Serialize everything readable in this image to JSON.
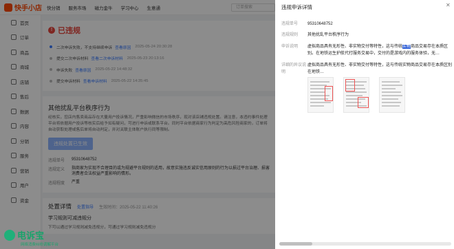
{
  "topbar": {
    "logo_text": "快手小店",
    "nav": [
      "快分销",
      "服务市场",
      "磁力金牛",
      "学习中心",
      "生意通"
    ],
    "search_placeholder": "订单搜索"
  },
  "sidebar": {
    "items": [
      "首页",
      "订单",
      "商品",
      "商城",
      "店铺",
      "售后",
      "数据",
      "内容",
      "分销",
      "服务",
      "营销",
      "用户",
      "资金"
    ]
  },
  "main": {
    "status": "已违规",
    "timeline": [
      {
        "text": "二次申诉失败，不支持继续申诉",
        "link": "查看原因",
        "time": "2025-05-24 20:30:28"
      },
      {
        "text": "提交二次申诉材料",
        "link": "查看二次申诉材料",
        "time": "2025-05-23 20:13:16"
      },
      {
        "text": "申诉失败",
        "link": "查看原因",
        "time": "2025-05-22 14:48:32"
      },
      {
        "text": "提交申诉材料",
        "link": "查看申诉材料",
        "time": "2025-05-22 14:35:45"
      }
    ],
    "section_title": "其他扰乱平台秩序行为",
    "description": "经核实，您店内售卖商品存在大量用户投诉情况，严重影响微信的市场秩序，现对该店铺违规处置。请注意，本违约事件处理平台将依据用户投诉等核实后给予如有疑问，可进行申诉或联系平台。同时平台依据商家行为判定为高危风险商家的，订单将自动获取处理或售后单将自动判定，并对关联主体账户执行同等限制。",
    "action_button": "违规处置已生效",
    "violation_no_label": "违规单号",
    "violation_no": "95310648752",
    "violation_def_label": "违规定义",
    "violation_def": "指商家为实现不合理目的或为规避平台规则的适用，故意实施违反诚实信用原则的行为以损过平台治理、损害消费者合法权益严重影响的情形。",
    "violation_level_label": "违规程度",
    "violation_level": "严重",
    "process_title": "处置详情",
    "process_link": "处置指导",
    "process_time": "生效时间：2025-05-22 11:40:26",
    "learn_title": "学习规则可减违规分",
    "learn_sub": "下可以通过学习规则减免违规分，可通过学习规则减免违规分"
  },
  "drawer": {
    "title": "违规申诉详情",
    "close_icon": "close-icon",
    "row1_label": "违规单号",
    "row1_value": "95310648752",
    "row2_label": "违规规则",
    "row2_value": "其他扰乱平台秩序行为",
    "row3_label": "申诉说明",
    "row3_value_pre": "虚拟商品具有无形性、非实物交付等特性，这与传统",
    "row3_value_hl": "实物",
    "row3_value_post": "商品交易存在本质区别。在地铁运生护航代打服务交易中，交付的是游戏内的服务体验，无…",
    "row4_label": "详细的异议说明",
    "row4_value": "虚拟商品具有无形性、非实物交付等特性，这与传统实物商品交易存在本质区别在地铁…"
  },
  "watermark": {
    "title": "电诉宝",
    "subtitle": "网络消费纠纷调解平台"
  }
}
